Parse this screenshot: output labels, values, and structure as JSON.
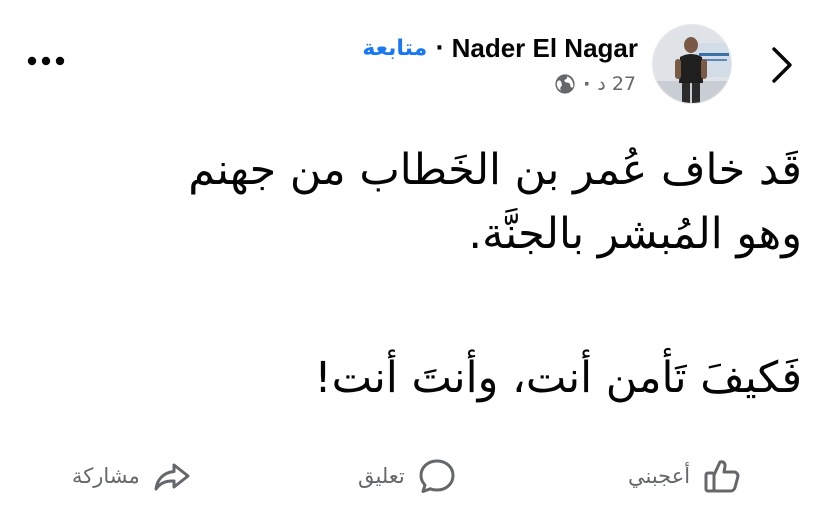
{
  "post": {
    "author_name": "Nader El Nagar",
    "follow_label": "متابعة",
    "separator": "·",
    "time_label": "27 د",
    "body_lines": [
      "قَد خاف عُمر بن الخَطاب من جهنم",
      "وهو المُبشر بالجنَّة.",
      "فَكيفَ تَأمن أنت، وأنتَ أنت!"
    ]
  },
  "actions": {
    "like_label": "أعجبني",
    "comment_label": "تعليق",
    "share_label": "مشاركة"
  },
  "icons": {
    "back": "chevron-right-icon",
    "more": "more-dots-icon",
    "privacy": "globe-icon",
    "like": "thumbs-up-icon",
    "comment": "speech-bubble-icon",
    "share": "share-arrow-icon"
  },
  "colors": {
    "accent": "#1877f2",
    "secondary_text": "#65676b",
    "primary_text": "#050505"
  }
}
